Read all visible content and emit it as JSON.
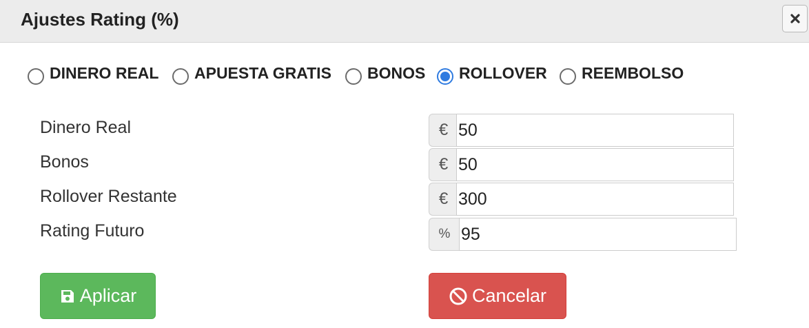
{
  "dialog": {
    "title": "Ajustes Rating (%)",
    "close_icon": "close-icon"
  },
  "radio_group": {
    "options": [
      {
        "label": "DINERO REAL",
        "checked": false
      },
      {
        "label": "APUESTA GRATIS",
        "checked": false
      },
      {
        "label": "BONOS",
        "checked": false
      },
      {
        "label": "ROLLOVER",
        "checked": true
      },
      {
        "label": "REEMBOLSO",
        "checked": false
      }
    ],
    "accent_color": "#2f7be0"
  },
  "fields": [
    {
      "label": "Dinero Real",
      "addon": "€",
      "value": "50"
    },
    {
      "label": "Bonos",
      "addon": "€",
      "value": "50"
    },
    {
      "label": "Rollover Restante",
      "addon": "€",
      "value": "300"
    },
    {
      "label": "Rating Futuro",
      "addon": "%",
      "value": "95"
    }
  ],
  "actions": {
    "apply_label": "Aplicar",
    "apply_icon": "floppy-disk-icon",
    "apply_color": "#5cb85c",
    "cancel_label": "Cancelar",
    "cancel_icon": "ban-icon",
    "cancel_color": "#d9534f"
  }
}
